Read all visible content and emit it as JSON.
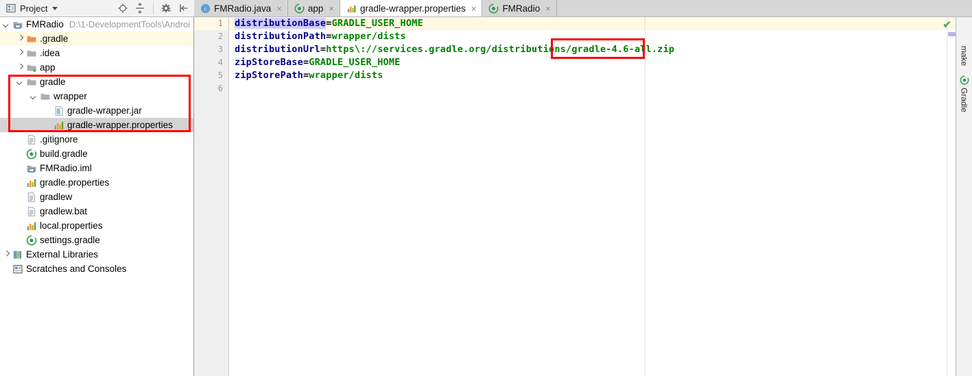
{
  "toolbar": {
    "project_label": "Project",
    "icons": [
      {
        "name": "locate-target-icon"
      },
      {
        "name": "collapse-all-icon"
      },
      {
        "name": "settings-gear-icon"
      },
      {
        "name": "hide-panel-icon"
      }
    ]
  },
  "tabs": [
    {
      "label": "FMRadio.java",
      "icon": "java-class-icon",
      "active": false,
      "close": "×"
    },
    {
      "label": "app",
      "icon": "gradle-icon",
      "active": false,
      "close": "×"
    },
    {
      "label": "gradle-wrapper.properties",
      "icon": "properties-icon",
      "active": true,
      "close": "×"
    },
    {
      "label": "FMRadio",
      "icon": "gradle-icon",
      "active": false,
      "close": "×"
    }
  ],
  "tree": {
    "root": {
      "label": "FMRadio",
      "path": "D:\\1-DevelopmentTools\\Androi",
      "icon": "module-icon"
    },
    "items": [
      {
        "label": ".gradle",
        "icon": "folder-orange-icon",
        "indent": 1,
        "arrow": "right",
        "highlight": "yellow"
      },
      {
        "label": ".idea",
        "icon": "folder-icon",
        "indent": 1,
        "arrow": "right",
        "highlight": "none"
      },
      {
        "label": "app",
        "icon": "folder-module-icon",
        "indent": 1,
        "arrow": "right",
        "highlight": "none"
      },
      {
        "label": "gradle",
        "icon": "folder-icon",
        "indent": 1,
        "arrow": "down",
        "highlight": "none"
      },
      {
        "label": "wrapper",
        "icon": "folder-icon",
        "indent": 2,
        "arrow": "down",
        "highlight": "none"
      },
      {
        "label": "gradle-wrapper.jar",
        "icon": "jar-icon",
        "indent": 3,
        "arrow": "none",
        "highlight": "none"
      },
      {
        "label": "gradle-wrapper.properties",
        "icon": "properties-icon",
        "indent": 3,
        "arrow": "none",
        "highlight": "gray"
      },
      {
        "label": ".gitignore",
        "icon": "text-file-icon",
        "indent": 1,
        "arrow": "none",
        "highlight": "none"
      },
      {
        "label": "build.gradle",
        "icon": "gradle-icon",
        "indent": 1,
        "arrow": "none",
        "highlight": "none"
      },
      {
        "label": "FMRadio.iml",
        "icon": "module-icon",
        "indent": 1,
        "arrow": "none",
        "highlight": "none"
      },
      {
        "label": "gradle.properties",
        "icon": "properties-icon",
        "indent": 1,
        "arrow": "none",
        "highlight": "none"
      },
      {
        "label": "gradlew",
        "icon": "text-file-icon",
        "indent": 1,
        "arrow": "none",
        "highlight": "none"
      },
      {
        "label": "gradlew.bat",
        "icon": "text-file-icon",
        "indent": 1,
        "arrow": "none",
        "highlight": "none"
      },
      {
        "label": "local.properties",
        "icon": "properties-icon",
        "indent": 1,
        "arrow": "none",
        "highlight": "none"
      },
      {
        "label": "settings.gradle",
        "icon": "gradle-icon",
        "indent": 1,
        "arrow": "none",
        "highlight": "none"
      },
      {
        "label": "External Libraries",
        "icon": "libraries-icon",
        "indent": 0,
        "arrow": "right",
        "highlight": "none"
      },
      {
        "label": "Scratches and Consoles",
        "icon": "scratches-icon",
        "indent": 0,
        "arrow": "none",
        "highlight": "none"
      }
    ]
  },
  "editor": {
    "line_numbers": [
      "1",
      "2",
      "3",
      "4",
      "5",
      "6"
    ],
    "lines": [
      {
        "key": "distributionBase",
        "eq": "=",
        "value": "GRADLE_USER_HOME",
        "key_selected": true
      },
      {
        "key": "distributionPath",
        "eq": "=",
        "value": "wrapper/dists",
        "key_selected": false
      },
      {
        "key": "distributionUrl",
        "eq": "=",
        "value": "https\\://services.gradle.org/distributions/gradle-4.6-all.zip",
        "key_selected": false
      },
      {
        "key": "zipStoreBase",
        "eq": "=",
        "value": "GRADLE_USER_HOME",
        "key_selected": false
      },
      {
        "key": "zipStorePath",
        "eq": "=",
        "value": "wrapper/dists",
        "key_selected": false
      }
    ],
    "inspection_status": "✔"
  },
  "rightbar": {
    "tabs": [
      {
        "label": "make",
        "icon": "none"
      },
      {
        "label": "Gradle",
        "icon": "gradle-icon"
      }
    ]
  },
  "annotations": {
    "tree_box_note": "gradle / wrapper / gradle-wrapper.properties",
    "code_box_note": "gradle-4.6-all.zip"
  },
  "colors": {
    "annotation_red": "#f80000",
    "key_blue": "#000082",
    "value_green": "#008000",
    "selection_lavender": "#ccccff",
    "current_line": "#fdf9e4",
    "selected_row_gray": "#d4d4d4"
  }
}
